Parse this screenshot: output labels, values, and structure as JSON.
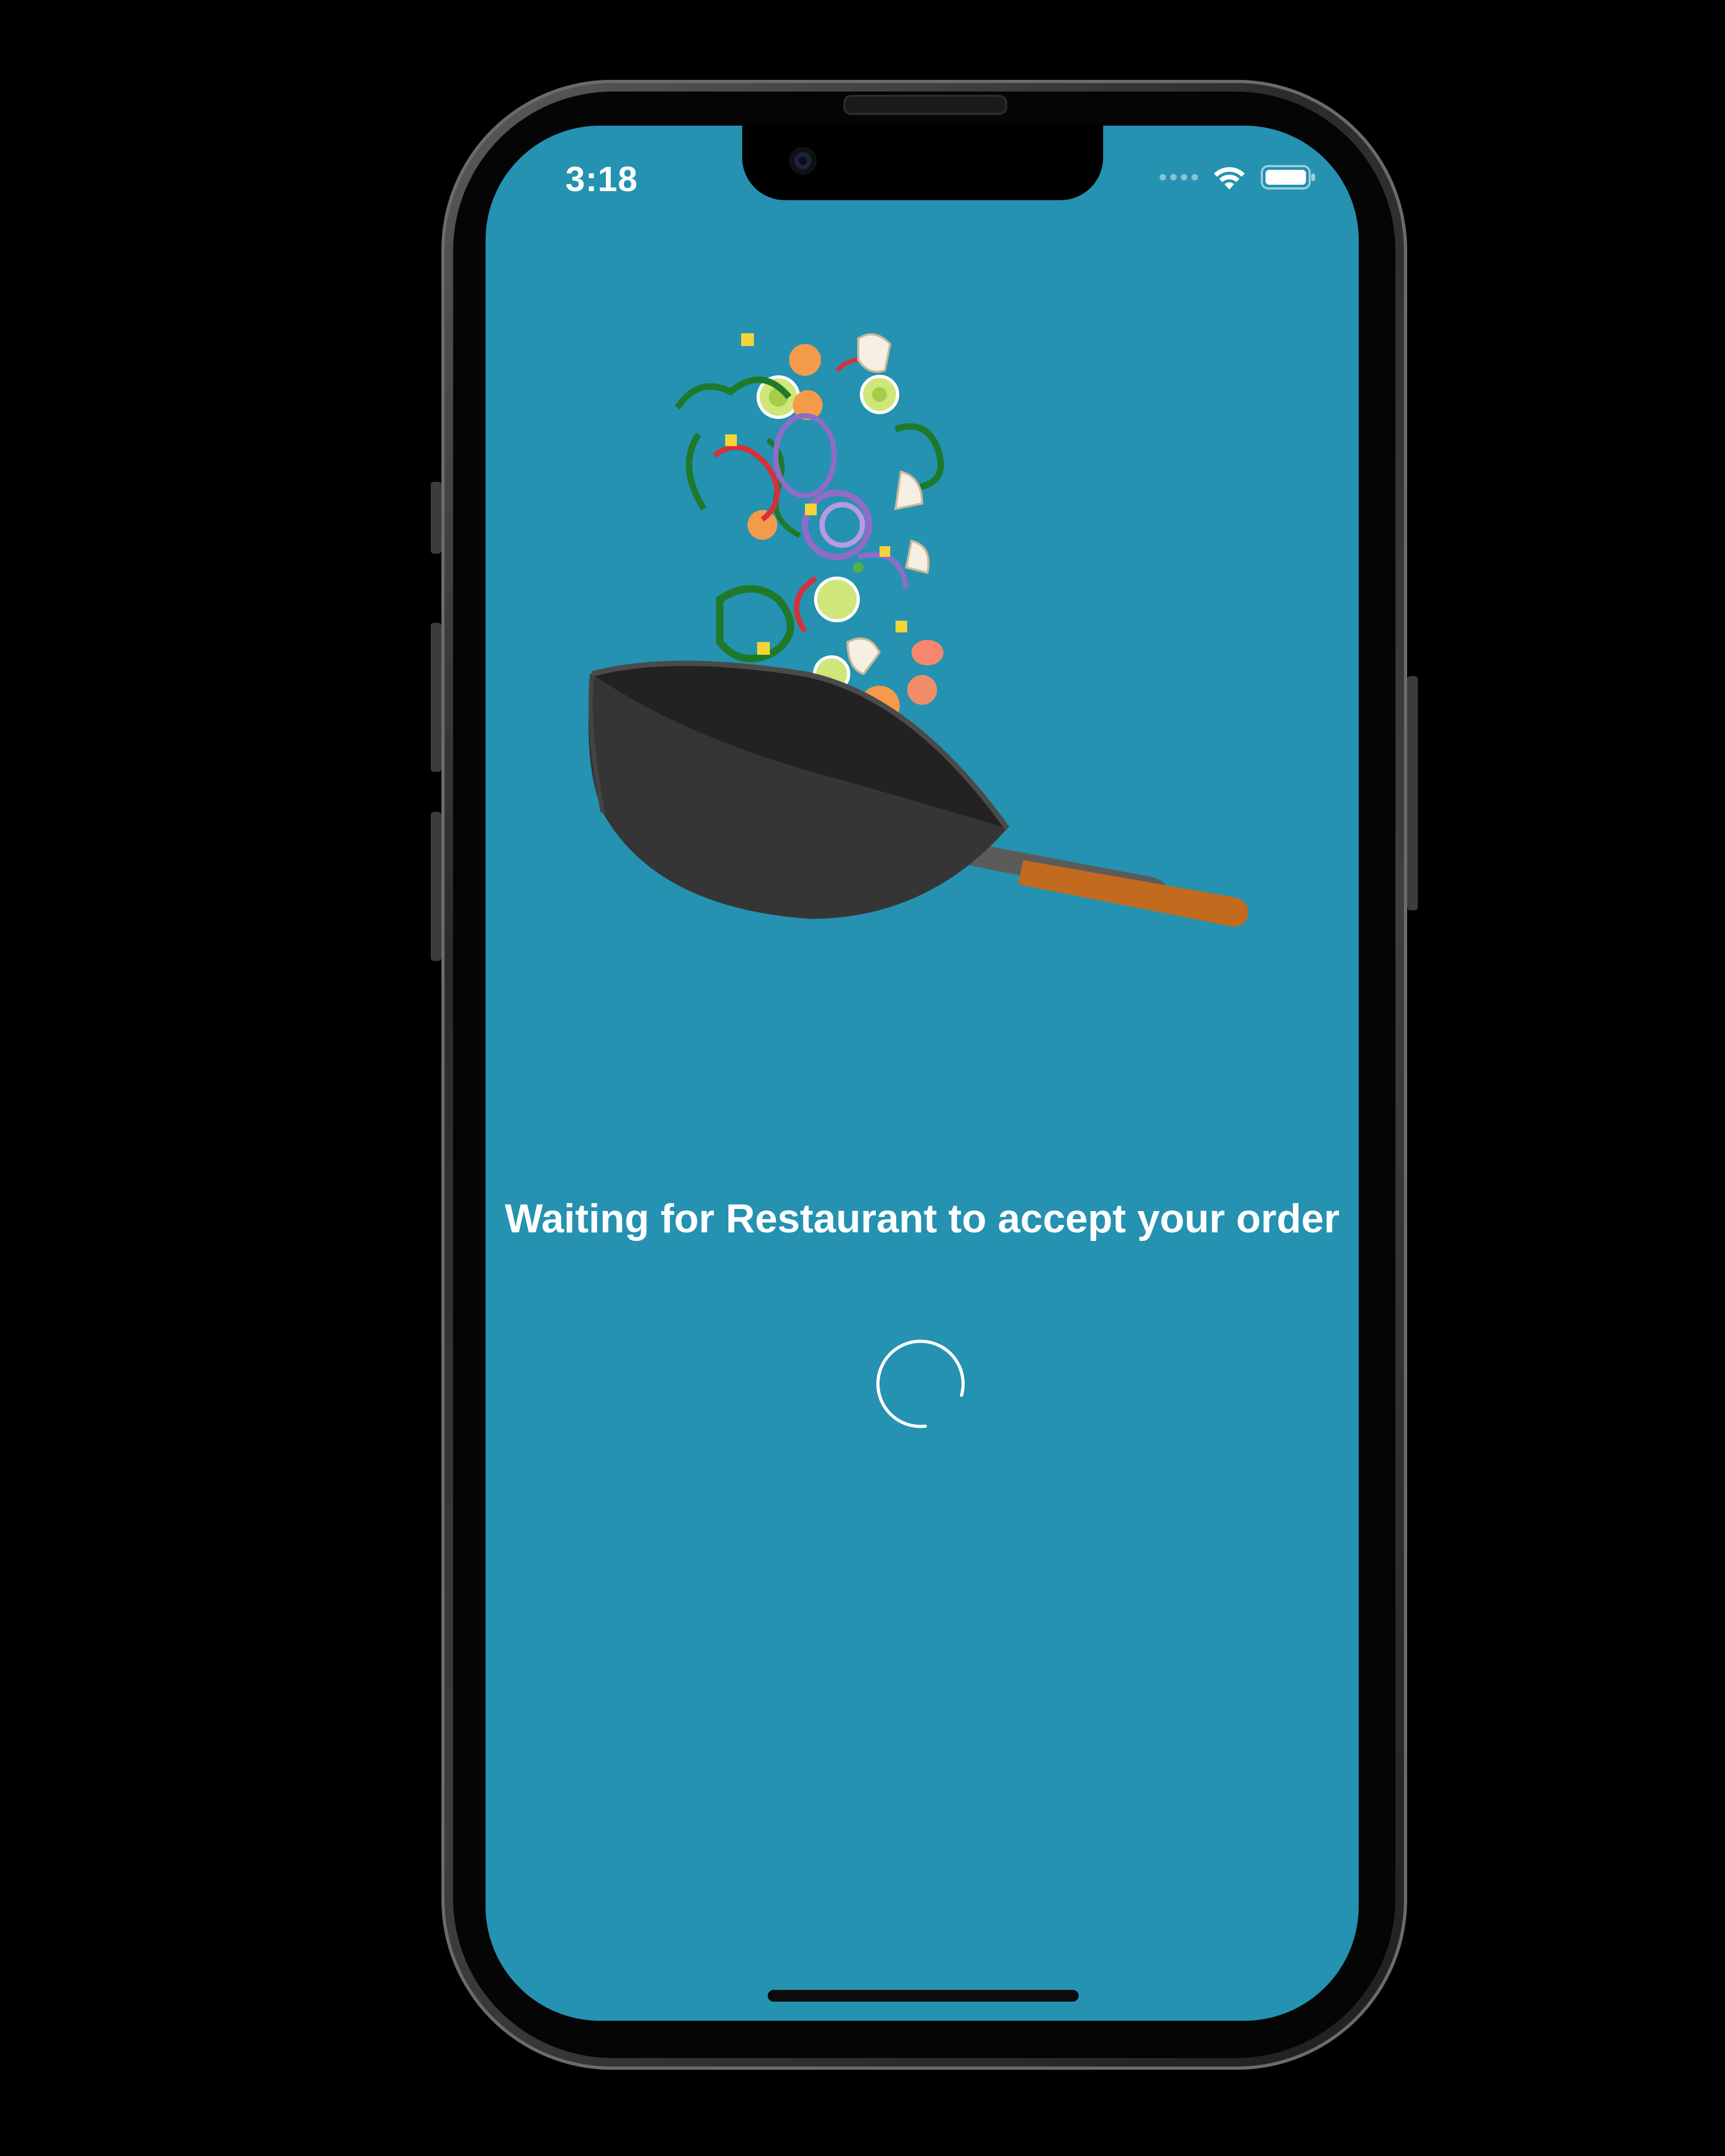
{
  "status_bar": {
    "time": "3:18",
    "wifi_icon": "wifi-icon",
    "battery_icon": "battery-icon"
  },
  "screen": {
    "background_color": "#2492b0",
    "illustration": "wok-with-flying-vegetables",
    "message": "Waiting for Restaurant to accept your order",
    "spinner_icon": "loading-spinner-icon"
  }
}
